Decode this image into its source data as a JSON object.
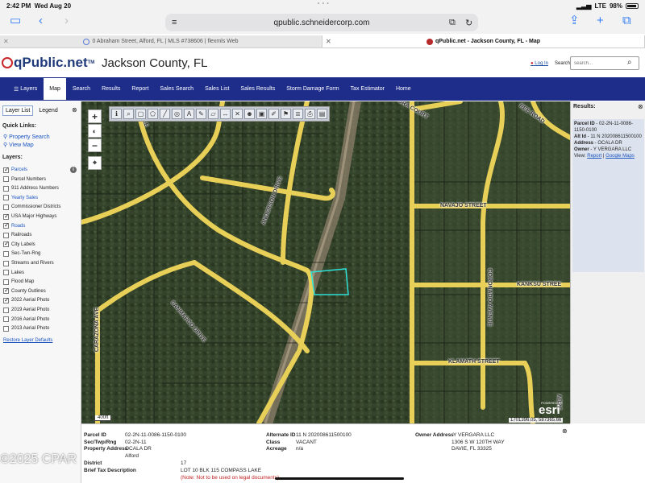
{
  "status": {
    "time": "2:42 PM",
    "date": "Wed Aug 20",
    "network": "LTE",
    "battery": "98%"
  },
  "browser": {
    "url": "qpublic.schneidercorp.com",
    "tabs": [
      {
        "label": "0 Abraham Street, Alford, FL | MLS #738606 | flexmls Web"
      },
      {
        "label": "qPublic.net - Jackson County, FL - Map"
      }
    ]
  },
  "header": {
    "logo": "qPublic.net",
    "logo_tm": "TM",
    "county": "Jackson County, FL",
    "login": "Log In",
    "search_link": "Search",
    "search_placeholder": "search..."
  },
  "nav": [
    "Layers",
    "Map",
    "Search",
    "Results",
    "Report",
    "Sales Search",
    "Sales List",
    "Sales Results",
    "Storm Damage Form",
    "Tax Estimator",
    "Home"
  ],
  "left_panel": {
    "tab_layer_list": "Layer List",
    "tab_legend": "Legend",
    "quick_links_title": "Quick Links:",
    "quick_links": [
      "Property Search",
      "View Map"
    ],
    "layers_title": "Layers:",
    "layers": [
      {
        "label": "Parcels",
        "checked": true,
        "link": true
      },
      {
        "label": "Parcel Numbers",
        "checked": false,
        "link": false
      },
      {
        "label": "911 Address Numbers",
        "checked": false,
        "link": false
      },
      {
        "label": "Yearly Sales",
        "checked": false,
        "link": true
      },
      {
        "label": "Commissioner Districts",
        "checked": false,
        "link": false
      },
      {
        "label": "USA Major Highways",
        "checked": true,
        "link": false
      },
      {
        "label": "Roads",
        "checked": true,
        "link": true
      },
      {
        "label": "Railroads",
        "checked": false,
        "link": false
      },
      {
        "label": "City Labels",
        "checked": true,
        "link": false
      },
      {
        "label": "Sec-Twn-Rng",
        "checked": false,
        "link": false
      },
      {
        "label": "Streams and Rivers",
        "checked": false,
        "link": false
      },
      {
        "label": "Lakes",
        "checked": false,
        "link": false
      },
      {
        "label": "Flood Map",
        "checked": false,
        "link": false
      },
      {
        "label": "County Outlines",
        "checked": true,
        "link": false
      },
      {
        "label": "2022 Aerial Photo",
        "checked": true,
        "link": false
      },
      {
        "label": "2019 Aerial Photo",
        "checked": false,
        "link": false
      },
      {
        "label": "2016 Aerial Photo",
        "checked": false,
        "link": false
      },
      {
        "label": "2013 Aerial Photo",
        "checked": false,
        "link": false
      }
    ],
    "restore": "Restore Layer Defaults"
  },
  "map": {
    "streets": {
      "anderson": "ANDERSON DRIVE",
      "sandmarco": "SANMARCO DRIVE",
      "carazona": "CARAZONA AVE",
      "coronado": "CORONADO AVENUE",
      "navajo": "NAVAJO STREET",
      "kanksu": "KANKSU STREE",
      "klamath": "KLAMATH STREET",
      "bee": "REE ROAD",
      "sec_ave": "ABRE",
      "cir": "CIRCLE",
      "gra": "GRA COURT",
      "kr": "KR"
    },
    "scale": "400ft",
    "esri": "esri",
    "powered_by": "POWERED BY",
    "coords": "1701396.05, 587365.66"
  },
  "results": {
    "title": "Results:",
    "parcel_id_label": "Parcel ID",
    "parcel_id": "02-2N-11-0086-1150-0100",
    "alt_id_label": "Alt Id",
    "alt_id": "11 N 202008611500100",
    "address_label": "Address",
    "address": "OCALA DR",
    "owner_label": "Owner",
    "owner": "Y VERGARA LLC",
    "view_label": "View:",
    "view_report": "Report",
    "view_google": "Google Maps"
  },
  "detail": {
    "parcel_id_label": "Parcel ID",
    "parcel_id": "02-2N-11-0086-1150-0100",
    "sec_label": "Sec/Twp/Rng",
    "sec": "02-2N-11",
    "property_address_label": "Property Address",
    "property_address_1": "OCALA DR",
    "property_address_2": "Alford",
    "district_label": "District",
    "district": "17",
    "brief_label": "Brief Tax Description",
    "brief_1": "LOT 10 BLK 115 COMPASS LAKE",
    "brief_2": "(Note: Not to be used on legal documents)",
    "alt_id_label": "Alternate ID",
    "alt_id": "11 N 202008611500100",
    "class_label": "Class",
    "class": "VACANT",
    "acreage_label": "Acreage",
    "acreage": "n/a",
    "owner_address_label": "Owner Address",
    "owner_1": "Y VERGARA LLC",
    "owner_2": "1306 S W 120TH WAY",
    "owner_3": "DAVIE, FL 33325"
  },
  "watermark": "©2025 CPAR"
}
